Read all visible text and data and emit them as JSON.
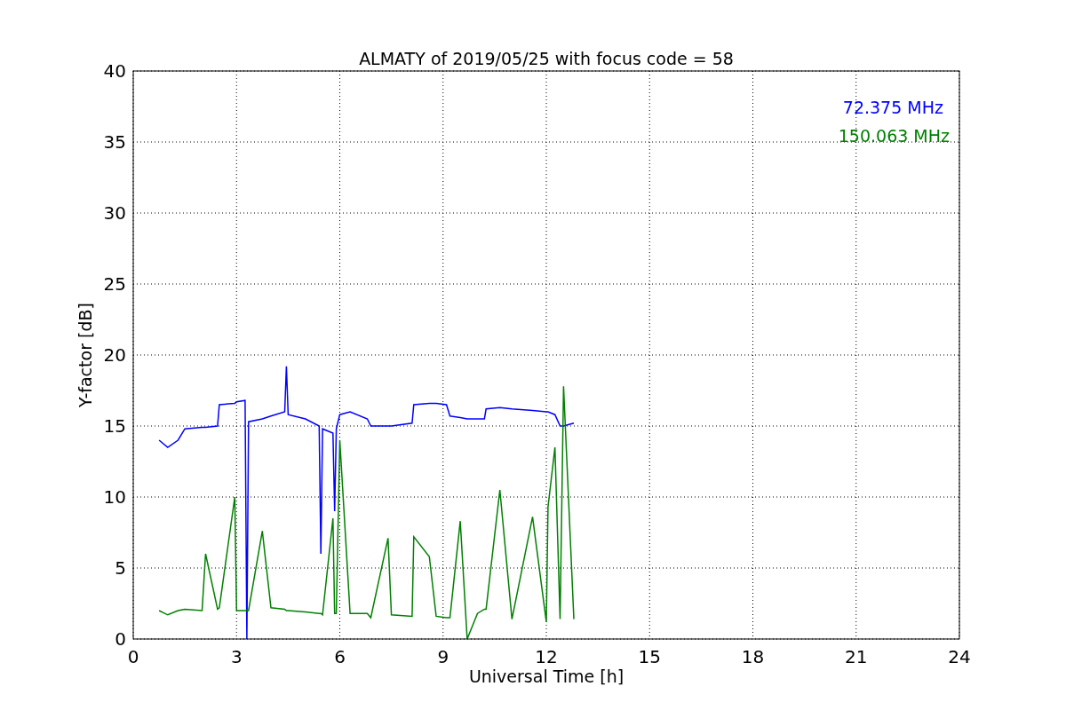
{
  "chart_data": {
    "type": "line",
    "title": "ALMATY of 2019/05/25 with focus code = 58",
    "xlabel": "Universal Time [h]",
    "ylabel": "Y-factor [dB]",
    "x": [
      0.75,
      1.0,
      1.3,
      1.5,
      2.0,
      2.1,
      2.45,
      2.5,
      2.95,
      3.0,
      3.25,
      3.3,
      3.35,
      3.75,
      4.0,
      4.4,
      4.45,
      4.5,
      5.0,
      5.4,
      5.45,
      5.5,
      5.8,
      5.85,
      5.9,
      6.0,
      6.3,
      6.8,
      6.9,
      7.4,
      7.5,
      8.1,
      8.15,
      8.6,
      8.8,
      9.1,
      9.2,
      9.5,
      9.7,
      10.0,
      10.2,
      10.25,
      10.65,
      11.0,
      11.6,
      12.0,
      12.05,
      12.25,
      12.4,
      12.5,
      12.8
    ],
    "series": [
      {
        "name": "72.375 MHz",
        "color": "#0000ff",
        "values": [
          14,
          13.5,
          14,
          14.8,
          14.9,
          14.9,
          15,
          16.5,
          16.6,
          16.7,
          16.8,
          0,
          15.3,
          15.5,
          15.7,
          16,
          19.2,
          15.8,
          15.5,
          15,
          6,
          14.8,
          14.5,
          9,
          14.8,
          15.8,
          16,
          15.5,
          15,
          15,
          15,
          15.2,
          16.5,
          16.6,
          16.6,
          16.5,
          15.7,
          15.6,
          15.5,
          15.5,
          15.5,
          16.2,
          16.3,
          16.2,
          16.1,
          16,
          16,
          15.8,
          15,
          15,
          15.2
        ]
      },
      {
        "name": "150.063 MHz",
        "color": "#008000",
        "values": [
          2,
          1.7,
          2,
          2.1,
          2,
          6,
          2.1,
          2.2,
          10,
          2,
          2,
          2,
          2,
          7.6,
          2.2,
          2.1,
          2,
          2,
          1.9,
          1.8,
          1.8,
          1.7,
          8.5,
          1.8,
          1.8,
          14,
          1.8,
          1.8,
          1.5,
          7.1,
          1.7,
          1.6,
          7.2,
          5.8,
          1.6,
          1.5,
          1.5,
          8.3,
          0,
          1.8,
          2.1,
          2.1,
          10.5,
          1.4,
          8.6,
          1.2,
          9.3,
          13.5,
          1.4,
          17.8,
          1.4
        ]
      }
    ],
    "grid": true,
    "xlim": [
      0,
      24
    ],
    "ylim": [
      0,
      40
    ],
    "xticks": [
      0,
      3,
      6,
      9,
      12,
      15,
      18,
      21,
      24
    ],
    "yticks": [
      0,
      5,
      10,
      15,
      20,
      25,
      30,
      35,
      40
    ]
  }
}
